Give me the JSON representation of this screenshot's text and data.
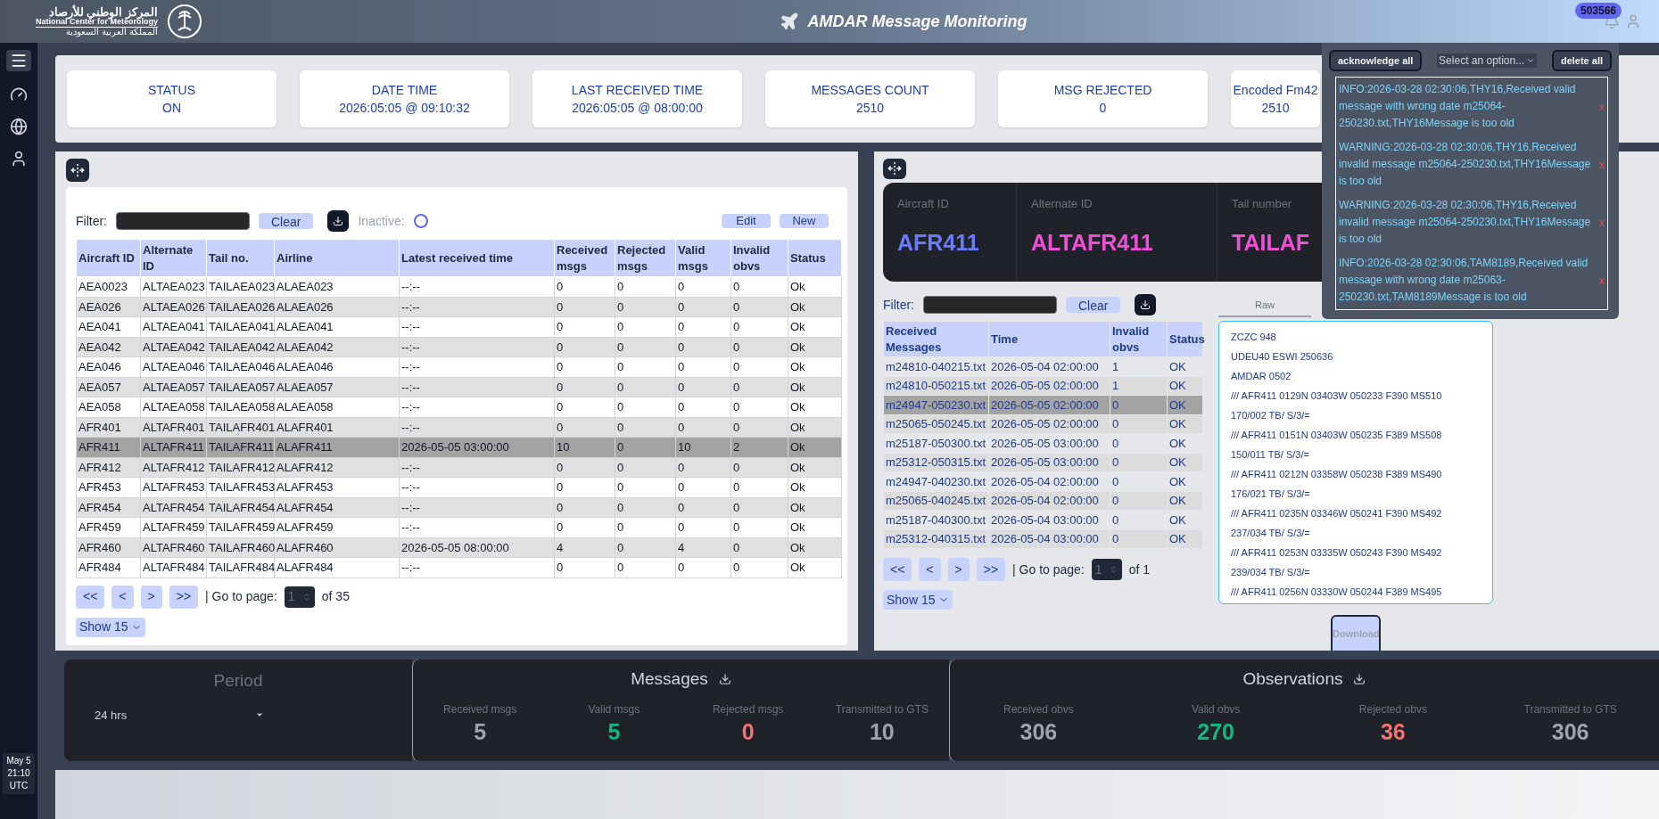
{
  "header": {
    "logo_arabic": "المركز الوطني للأرصاد",
    "logo_english": "National Center for Meteorology",
    "logo_arabic_sub": "المملكة العربية السعودية",
    "title": "AMDAR Message Monitoring",
    "badge": "503566"
  },
  "clock": {
    "date": "May 5",
    "time": "21:10",
    "zone": "UTC"
  },
  "stats": [
    {
      "label": "STATUS",
      "value": "ON",
      "kind": "wide"
    },
    {
      "label": "DATE TIME",
      "value": "2026:05:05 @ 09:10:32",
      "kind": "wide"
    },
    {
      "label": "LAST RECEIVED TIME",
      "value": "2026:05:05 @ 08:00:00",
      "kind": "wide"
    },
    {
      "label": "MESSAGES COUNT",
      "value": "2510",
      "kind": "wide"
    },
    {
      "label": "MSG REJECTED",
      "value": "0",
      "kind": "wide"
    },
    {
      "label": "Encoded Fm42",
      "value": "2510",
      "kind": "narrow"
    }
  ],
  "notifications": {
    "acknowledge": "acknowledge all",
    "select_placeholder": "Select an option...",
    "delete": "delete all",
    "items": [
      {
        "text": "INFO:2026-03-28 02:30:06,THY16,Received valid message with wrong date m25064-250230.txt,THY16Message is too old",
        "dismiss": "x"
      },
      {
        "text": "WARNING:2026-03-28 02:30:06,THY16,Received invalid message m25064-250230.txt,THY16Message is too old",
        "dismiss": "x"
      },
      {
        "text": "WARNING:2026-03-28 02:30:06,THY16,Received invalid message m25064-250230.txt,THY16Message is too old",
        "dismiss": "x"
      },
      {
        "text": "INFO:2026-03-28 02:30:06,TAM8189,Received valid message with wrong date m25063-250230.txt,TAM8189Message is too old",
        "dismiss": "x"
      }
    ]
  },
  "aircraft_table": {
    "filter_label": "Filter:",
    "clear": "Clear",
    "inactive_label": "Inactive:",
    "inactive": false,
    "edit": "Edit",
    "new": "New",
    "columns": [
      "Aircraft ID",
      "Alternate ID",
      "Tail no.",
      "Airline",
      "Latest received time",
      "Received msgs",
      "Rejected msgs",
      "Valid msgs",
      "Invalid obvs",
      "Status"
    ],
    "rows": [
      {
        "cells": [
          "AEA0023",
          "ALTAEA023",
          "TAILAEA023",
          "ALAEA023",
          "--:--",
          "0",
          "0",
          "0",
          "0",
          "Ok"
        ],
        "selected": false
      },
      {
        "cells": [
          "AEA026",
          "ALTAEA026",
          "TAILAEA026",
          "ALAEA026",
          "--:--",
          "0",
          "0",
          "0",
          "0",
          "Ok"
        ],
        "selected": false
      },
      {
        "cells": [
          "AEA041",
          "ALTAEA041",
          "TAILAEA041",
          "ALAEA041",
          "--:--",
          "0",
          "0",
          "0",
          "0",
          "Ok"
        ],
        "selected": false
      },
      {
        "cells": [
          "AEA042",
          "ALTAEA042",
          "TAILAEA042",
          "ALAEA042",
          "--:--",
          "0",
          "0",
          "0",
          "0",
          "Ok"
        ],
        "selected": false
      },
      {
        "cells": [
          "AEA046",
          "ALTAEA046",
          "TAILAEA046",
          "ALAEA046",
          "--:--",
          "0",
          "0",
          "0",
          "0",
          "Ok"
        ],
        "selected": false
      },
      {
        "cells": [
          "AEA057",
          "ALTAEA057",
          "TAILAEA057",
          "ALAEA057",
          "--:--",
          "0",
          "0",
          "0",
          "0",
          "Ok"
        ],
        "selected": false
      },
      {
        "cells": [
          "AEA058",
          "ALTAEA058",
          "TAILAEA058",
          "ALAEA058",
          "--:--",
          "0",
          "0",
          "0",
          "0",
          "Ok"
        ],
        "selected": false
      },
      {
        "cells": [
          "AFR401",
          "ALTAFR401",
          "TAILAFR401",
          "ALAFR401",
          "--:--",
          "0",
          "0",
          "0",
          "0",
          "Ok"
        ],
        "selected": false
      },
      {
        "cells": [
          "AFR411",
          "ALTAFR411",
          "TAILAFR411",
          "ALAFR411",
          "2026-05-05 03:00:00",
          "10",
          "0",
          "10",
          "2",
          "Ok"
        ],
        "selected": true
      },
      {
        "cells": [
          "AFR412",
          "ALTAFR412",
          "TAILAFR412",
          "ALAFR412",
          "--:--",
          "0",
          "0",
          "0",
          "0",
          "Ok"
        ],
        "selected": false
      },
      {
        "cells": [
          "AFR453",
          "ALTAFR453",
          "TAILAFR453",
          "ALAFR453",
          "--:--",
          "0",
          "0",
          "0",
          "0",
          "Ok"
        ],
        "selected": false
      },
      {
        "cells": [
          "AFR454",
          "ALTAFR454",
          "TAILAFR454",
          "ALAFR454",
          "--:--",
          "0",
          "0",
          "0",
          "0",
          "Ok"
        ],
        "selected": false
      },
      {
        "cells": [
          "AFR459",
          "ALTAFR459",
          "TAILAFR459",
          "ALAFR459",
          "--:--",
          "0",
          "0",
          "0",
          "0",
          "Ok"
        ],
        "selected": false
      },
      {
        "cells": [
          "AFR460",
          "ALTAFR460",
          "TAILAFR460",
          "ALAFR460",
          "2026-05-05 08:00:00",
          "4",
          "0",
          "4",
          "0",
          "Ok"
        ],
        "selected": false
      },
      {
        "cells": [
          "AFR484",
          "ALTAFR484",
          "TAILAFR484",
          "ALAFR484",
          "--:--",
          "0",
          "0",
          "0",
          "0",
          "Ok"
        ],
        "selected": false
      }
    ],
    "pager": {
      "first": "<<",
      "prev": "<",
      "next": ">",
      "last": ">>",
      "goto": "| Go to page:",
      "page": "1",
      "of": "of 35",
      "show": "Show 15"
    }
  },
  "details": {
    "fields": [
      {
        "label": "Aircraft ID",
        "value": "AFR411",
        "color": "#6b7bff"
      },
      {
        "label": "Alternate ID",
        "value": "ALTAFR411",
        "color": "#f04fd8"
      },
      {
        "label": "Tail number",
        "value": "TAILAF",
        "color": "#f04fd8"
      }
    ]
  },
  "messages_table": {
    "filter_label": "Filter:",
    "clear": "Clear",
    "columns": [
      "Received Messages",
      "Time",
      "Invalid obvs",
      "Status"
    ],
    "rows": [
      {
        "cells": [
          "m24810-040215.txt",
          "2026-05-04 02:00:00",
          "1",
          "OK"
        ],
        "selected": false
      },
      {
        "cells": [
          "m24810-050215.txt",
          "2026-05-05 02:00:00",
          "1",
          "OK"
        ],
        "selected": false
      },
      {
        "cells": [
          "m24947-050230.txt",
          "2026-05-05 02:00:00",
          "0",
          "OK"
        ],
        "selected": true
      },
      {
        "cells": [
          "m25065-050245.txt",
          "2026-05-05 02:00:00",
          "0",
          "OK"
        ],
        "selected": false
      },
      {
        "cells": [
          "m25187-050300.txt",
          "2026-05-05 03:00:00",
          "0",
          "OK"
        ],
        "selected": false
      },
      {
        "cells": [
          "m25312-050315.txt",
          "2026-05-05 03:00:00",
          "0",
          "OK"
        ],
        "selected": false
      },
      {
        "cells": [
          "m24947-040230.txt",
          "2026-05-04 02:00:00",
          "0",
          "OK"
        ],
        "selected": false
      },
      {
        "cells": [
          "m25065-040245.txt",
          "2026-05-04 02:00:00",
          "0",
          "OK"
        ],
        "selected": false
      },
      {
        "cells": [
          "m25187-040300.txt",
          "2026-05-04 03:00:00",
          "0",
          "OK"
        ],
        "selected": false
      },
      {
        "cells": [
          "m25312-040315.txt",
          "2026-05-04 03:00:00",
          "0",
          "OK"
        ],
        "selected": false
      }
    ],
    "pager": {
      "first": "<<",
      "prev": "<",
      "next": ">",
      "last": ">>",
      "goto": "| Go to page:",
      "page": "1",
      "of": "of 1",
      "show": "Show 15"
    }
  },
  "raw": {
    "tabs": [
      {
        "label": "Raw",
        "selected": true
      }
    ],
    "lines": [
      "ZCZC 948",
      "UDEU40 ESWI 250636",
      "AMDAR 0502",
      "/// AFR411 0129N 03403W 050233 F390 MS510",
      "170/002 TB/ S/3/=",
      "/// AFR411 0151N 03403W 050235 F389 MS508",
      "150/011 TB/ S/3/=",
      "/// AFR411 0212N 03358W 050238 F389 MS490",
      "176/021 TB/ S/3/=",
      "/// AFR411 0235N 03346W 050241 F390 MS492",
      "237/034 TB/ S/3/=",
      "/// AFR411 0253N 03335W 050243 F390 MS492",
      "239/034 TB/ S/3/=",
      "/// AFR411 0256N 03330W 050244 F389 MS495"
    ],
    "download": "Download"
  },
  "summary": {
    "period": {
      "title": "Period",
      "value": "24 hrs"
    },
    "groups": [
      {
        "title": "Messages",
        "stats": [
          {
            "label": "Received msgs",
            "value": "5",
            "color": "#9ca3af"
          },
          {
            "label": "Valid msgs",
            "value": "5",
            "color": "#10b981"
          },
          {
            "label": "Rejected msgs",
            "value": "0",
            "color": "#f87171"
          },
          {
            "label": "Transmitted to GTS",
            "value": "10",
            "color": "#9ca3af"
          }
        ]
      },
      {
        "title": "Observations",
        "stats": [
          {
            "label": "Received obvs",
            "value": "306",
            "color": "#9ca3af"
          },
          {
            "label": "Valid obvs",
            "value": "270",
            "color": "#10b981"
          },
          {
            "label": "Rejected obvs",
            "value": "36",
            "color": "#f87171"
          },
          {
            "label": "Transmitted to GTS",
            "value": "306",
            "color": "#9ca3af"
          }
        ]
      }
    ]
  }
}
